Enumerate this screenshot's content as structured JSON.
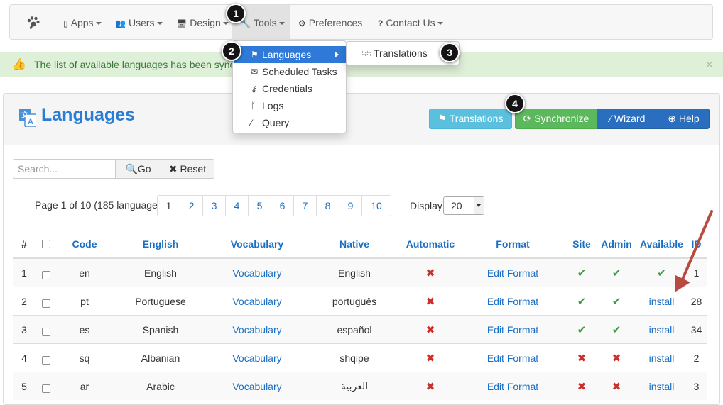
{
  "navbar": {
    "apps": "Apps",
    "users": "Users",
    "design": "Design",
    "tools": "Tools",
    "preferences": "Preferences",
    "contact": "Contact Us"
  },
  "badges": [
    "1",
    "2",
    "3",
    "4"
  ],
  "alert": {
    "message": "The list of available languages has been synchro"
  },
  "tools_menu": {
    "items": [
      "Languages",
      "Scheduled Tasks",
      "Credentials",
      "Logs",
      "Query"
    ]
  },
  "languages_submenu": {
    "item": "Translations"
  },
  "page": {
    "title": "Languages",
    "buttons": {
      "translations": "Translations",
      "synchronize": "Synchronize",
      "wizard": "Wizard",
      "help": "Help"
    }
  },
  "search": {
    "placeholder": "Search...",
    "go": "Go",
    "reset": "Reset"
  },
  "pagination": {
    "info": "Page 1 of 10 (185 language)",
    "pages": [
      "1",
      "2",
      "3",
      "4",
      "5",
      "6",
      "7",
      "8",
      "9",
      "10"
    ],
    "current_page": "1",
    "display_label": "Display",
    "display_value": "20"
  },
  "table": {
    "headers": {
      "num": "#",
      "code": "Code",
      "english": "English",
      "vocabulary": "Vocabulary",
      "native": "Native",
      "automatic": "Automatic",
      "format": "Format",
      "site": "Site",
      "admin": "Admin",
      "available": "Available",
      "id": "ID"
    },
    "rows": [
      {
        "num": "1",
        "code": "en",
        "english": "English",
        "vocabulary": "Vocabulary",
        "native": "English",
        "automatic": "no",
        "format": "Edit Format",
        "site": "yes",
        "admin": "yes",
        "available": "yes",
        "available_text": "",
        "id": "1"
      },
      {
        "num": "2",
        "code": "pt",
        "english": "Portuguese",
        "vocabulary": "Vocabulary",
        "native": "português",
        "automatic": "no",
        "format": "Edit Format",
        "site": "yes",
        "admin": "yes",
        "available": "install",
        "available_text": "install",
        "id": "28"
      },
      {
        "num": "3",
        "code": "es",
        "english": "Spanish",
        "vocabulary": "Vocabulary",
        "native": "español",
        "automatic": "no",
        "format": "Edit Format",
        "site": "yes",
        "admin": "yes",
        "available": "install",
        "available_text": "install",
        "id": "34"
      },
      {
        "num": "4",
        "code": "sq",
        "english": "Albanian",
        "vocabulary": "Vocabulary",
        "native": "shqipe",
        "automatic": "no",
        "format": "Edit Format",
        "site": "no",
        "admin": "no",
        "available": "install",
        "available_text": "install",
        "id": "2"
      },
      {
        "num": "5",
        "code": "ar",
        "english": "Arabic",
        "vocabulary": "Vocabulary",
        "native": "العربية",
        "automatic": "no",
        "format": "Edit Format",
        "site": "no",
        "admin": "no",
        "available": "install",
        "available_text": "install",
        "id": "3"
      }
    ]
  },
  "colors": {
    "accent": "#2a7dd6",
    "success": "#5cb85c",
    "info": "#5bc0de",
    "primary": "#2a6fbf",
    "danger": "#c9302c",
    "annotation_arrow": "#b84a42"
  },
  "icons": {
    "logo": "paw-icon",
    "apps": "mobile-icon",
    "users": "users-icon",
    "design": "monitor-icon",
    "tools": "wrench-icon",
    "preferences": "gears-icon",
    "contact": "question-icon",
    "alert": "thumbs-up-icon",
    "languages": "flag-icon",
    "scheduled_tasks": "envelope-icon",
    "credentials": "key-icon",
    "logs": "branch-icon",
    "query": "magic-wand-icon"
  }
}
